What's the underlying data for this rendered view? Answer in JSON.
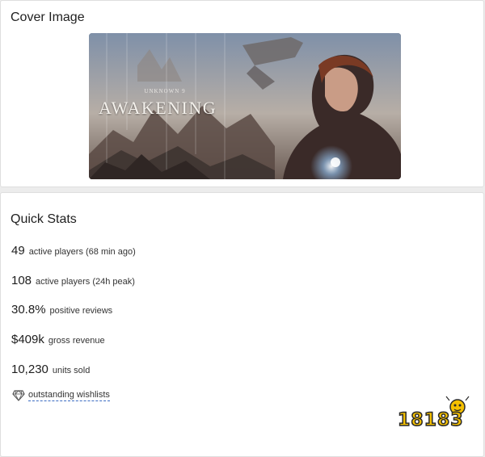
{
  "cover_section": {
    "title": "Cover Image",
    "art": {
      "subtitle": "UNKNOWN 9",
      "title": "AWAKENING"
    }
  },
  "stats_section": {
    "title": "Quick Stats",
    "stats": [
      {
        "value": "49",
        "label": "active players (68 min ago)"
      },
      {
        "value": "108",
        "label": "active players (24h peak)"
      },
      {
        "value": "30.8%",
        "label": "positive reviews"
      },
      {
        "value": "$409k",
        "label": "gross revenue"
      },
      {
        "value": "10,230",
        "label": "units sold"
      }
    ],
    "wishlist": {
      "icon": "diamond-icon",
      "label": "outstanding wishlists",
      "link_color": "#3a6bc2"
    }
  },
  "watermark": {
    "text": "18183",
    "color": "#f5c000"
  }
}
